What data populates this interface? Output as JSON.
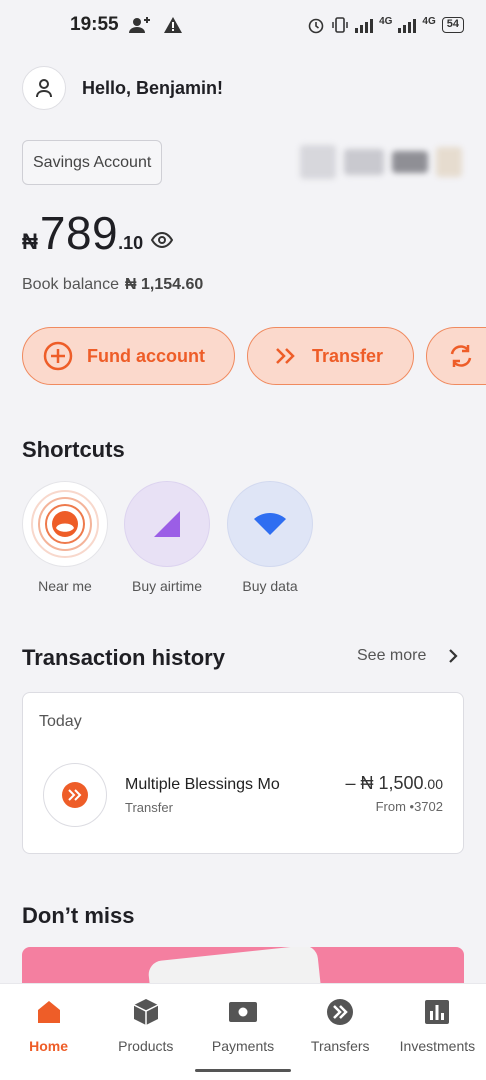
{
  "status_bar": {
    "time": "19:55",
    "net1": "4G",
    "net2": "4G",
    "battery": "54"
  },
  "header": {
    "greeting": "Hello, Benjamin!"
  },
  "account": {
    "type": "Savings Account"
  },
  "balance": {
    "currency": "₦",
    "main": "789",
    "decimal": ".10",
    "book_label": "Book balance",
    "book_value": "₦ 1,154.60"
  },
  "actions": [
    {
      "label": "Fund account"
    },
    {
      "label": "Transfer"
    }
  ],
  "shortcuts": {
    "title": "Shortcuts",
    "items": [
      {
        "label": "Near me"
      },
      {
        "label": "Buy airtime"
      },
      {
        "label": "Buy data"
      }
    ]
  },
  "transactions": {
    "title": "Transaction history",
    "see_more": "See more",
    "group": "Today",
    "items": [
      {
        "name": "Multiple Blessings Mo",
        "type": "Transfer",
        "amount": "– ₦ 1,500",
        "amount_decimal": ".00",
        "source": "From •3702"
      }
    ]
  },
  "promo": {
    "title": "Don’t miss"
  },
  "nav": [
    {
      "label": "Home",
      "icon": "home-icon",
      "active": true
    },
    {
      "label": "Products",
      "icon": "box-icon"
    },
    {
      "label": "Payments",
      "icon": "payments-icon"
    },
    {
      "label": "Transfers",
      "icon": "transfers-icon"
    },
    {
      "label": "Investments",
      "icon": "investments-icon"
    }
  ],
  "colors": {
    "accent": "#ee5d28",
    "accent_light": "#fbd9cc",
    "background": "#f3f3f6"
  }
}
